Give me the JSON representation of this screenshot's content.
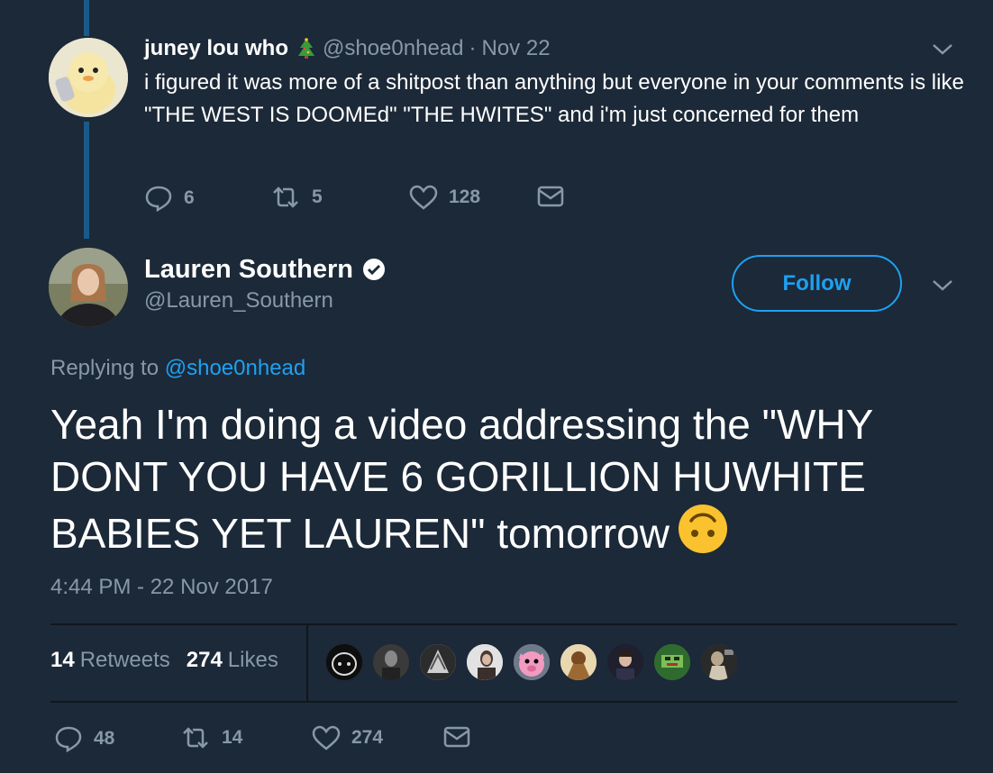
{
  "reply": {
    "name": "juney lou who",
    "handle": "@shoe0nhead",
    "separator": "·",
    "date": "Nov 22",
    "text": "i figured it was more of a shitpost than anything but everyone in your comments is like \"THE WEST IS DOOMEd\" \"THE HWITES\" and i'm just concerned for them",
    "replies": "6",
    "retweets": "5",
    "likes": "128"
  },
  "tweet": {
    "name": "Lauren Southern",
    "handle": "@Lauren_Southern",
    "follow_label": "Follow",
    "replying_prefix": "Replying to",
    "replying_handle": "@shoe0nhead",
    "text": "Yeah I'm doing a video addressing the \"WHY DONT YOU HAVE 6 GORILLION HUWHITE BABIES YET LAUREN\" tomorrow",
    "timestamp": "4:44 PM - 22 Nov 2017",
    "retweets_count": "14",
    "retweets_label": "Retweets",
    "likes_count": "274",
    "likes_label": "Likes",
    "replies": "48",
    "retweets": "14",
    "likes": "274"
  },
  "colors": {
    "background": "#1c2938",
    "accent": "#1da1f2",
    "muted": "#8899a6",
    "thread_line": "#1a5a8a"
  },
  "icons": [
    "reply-icon",
    "retweet-icon",
    "like-icon",
    "dm-icon",
    "verified-icon",
    "chevron-down-icon",
    "christmas-tree-icon",
    "upside-down-face-emoji"
  ]
}
